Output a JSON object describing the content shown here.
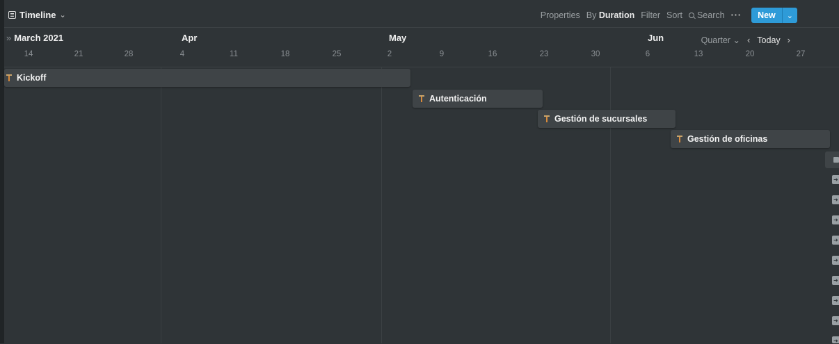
{
  "view": {
    "name": "Timeline"
  },
  "toolbar": {
    "properties": "Properties",
    "by_prefix": "By",
    "by_value": "Duration",
    "filter": "Filter",
    "sort": "Sort",
    "search": "Search",
    "more": "···",
    "new_label": "New"
  },
  "months": [
    "March 2021",
    "Apr",
    "May",
    "Jun"
  ],
  "days": [
    "14",
    "21",
    "28",
    "4",
    "11",
    "18",
    "25",
    "2",
    "9",
    "16",
    "23",
    "30",
    "6",
    "13",
    "20",
    "27"
  ],
  "nav": {
    "zoom": "Quarter",
    "today": "Today"
  },
  "tasks": [
    {
      "name": "Kickoff"
    },
    {
      "name": "Autenticación"
    },
    {
      "name": "Gestión de sucursales"
    },
    {
      "name": "Gestión de oficinas"
    }
  ],
  "colors": {
    "background": "#2f3437",
    "bar": "#3f4447",
    "accent": "#2e9bd8"
  },
  "icons": [
    "timeline-view-icon",
    "search-icon",
    "chevron-down-icon",
    "chevron-left-icon",
    "chevron-right-icon",
    "task-icon",
    "open-arrow-icon"
  ]
}
